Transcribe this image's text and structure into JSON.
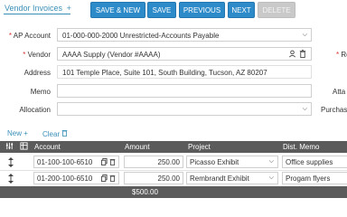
{
  "header": {
    "title": "Vendor Invoices",
    "title_plus": "+",
    "buttons": {
      "save_new": "SAVE & NEW",
      "save": "SAVE",
      "previous": "PREVIOUS",
      "next": "NEXT",
      "delete": "DELETE"
    }
  },
  "form": {
    "ap_account": {
      "label": "AP Account",
      "required": "*",
      "value": "01-000-000-2000 Unrestricted-Accounts Payable"
    },
    "vendor": {
      "label": "Vendor",
      "required": "*",
      "value": "AAAA Supply (Vendor #AAAA)"
    },
    "address": {
      "label": "Address",
      "value": "101 Temple Place, Suite 101, South Building, Tucson, AZ  80207"
    },
    "memo": {
      "label": "Memo",
      "value": ""
    },
    "allocation": {
      "label": "Allocation",
      "value": ""
    },
    "right_labels": {
      "re": "Re",
      "atta": "Atta",
      "purchase": "Purchas",
      "re_required": "*"
    }
  },
  "links": {
    "new": "New",
    "new_plus": "+",
    "clear": "Clear"
  },
  "grid": {
    "headers": {
      "account": "Account",
      "amount": "Amount",
      "project": "Project",
      "dist_memo": "Dist. Memo"
    },
    "rows": [
      {
        "account": "01-100-100-6510",
        "amount": "250.00",
        "project": "Picasso Exhibit",
        "dist_memo": "Office supplies"
      },
      {
        "account": "01-200-100-6510",
        "amount": "250.00",
        "project": "Rembrandt Exhibit",
        "dist_memo": "Progam flyers"
      }
    ],
    "total": "$500.00"
  },
  "colors": {
    "accent": "#2e8bc9",
    "link": "#3a8fb7",
    "grid_header": "#5b5b5b",
    "disabled": "#c9c9c9"
  },
  "icons": [
    "settings-icon",
    "filter-icon",
    "drag-icon",
    "copy-icon",
    "trash-icon",
    "chevron-down-icon",
    "contact-icon"
  ]
}
